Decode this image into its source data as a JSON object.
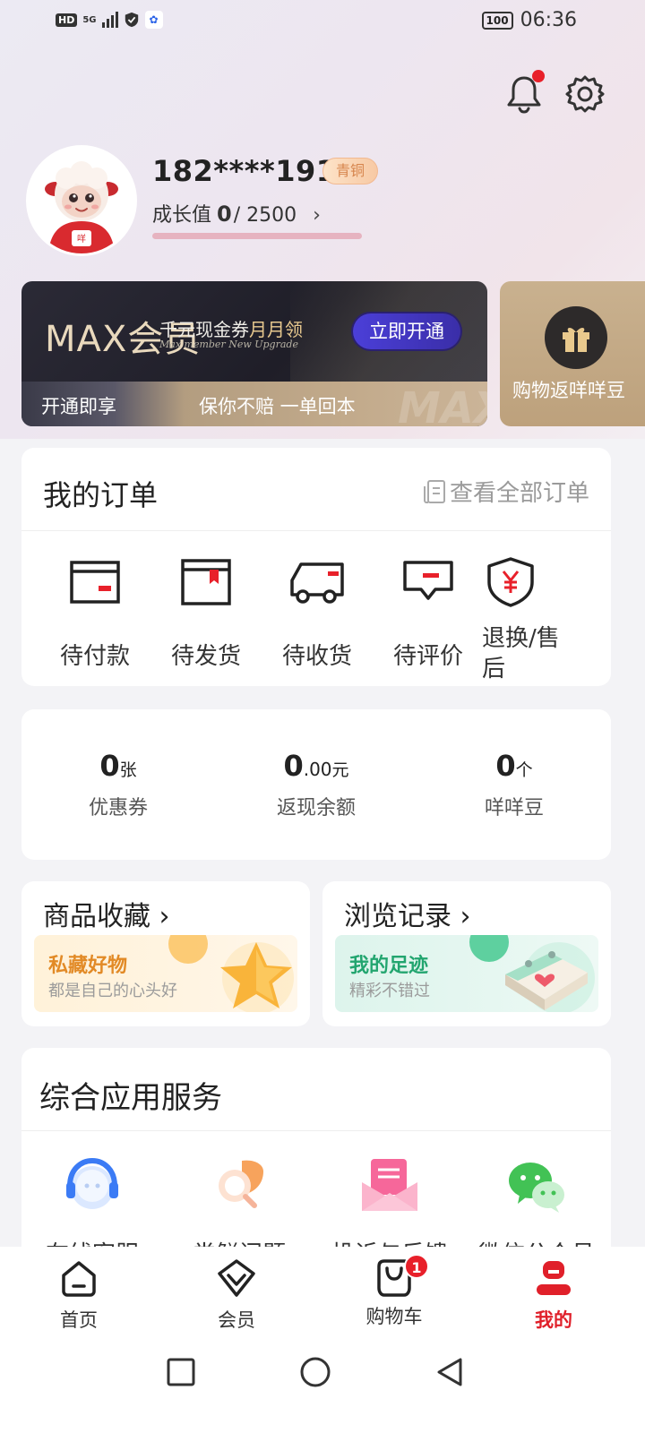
{
  "status_bar": {
    "hd": "HD",
    "network": "5G",
    "battery": "100",
    "time": "06:36"
  },
  "profile": {
    "phone": "182****1917",
    "level": "青铜",
    "growth_label": "成长值",
    "growth_current": "0",
    "growth_total": "/ 2500",
    "growth_progress": 0
  },
  "max_banner": {
    "logo": "MAX会员",
    "title_prefix": "千元现金券",
    "title_highlight": "月月领",
    "subtitle": "Max member   New Upgrade",
    "open_button": "立即开通",
    "left_label": "开通即享",
    "promise": "保你不赔 一单回本",
    "watermark": "MAX"
  },
  "rebate_banner": {
    "text": "购物返咩咩豆"
  },
  "orders": {
    "title": "我的订单",
    "view_all": "查看全部订单",
    "items": [
      {
        "label": "待付款",
        "icon": "wallet-icon"
      },
      {
        "label": "待发货",
        "icon": "box-icon"
      },
      {
        "label": "待收货",
        "icon": "truck-icon"
      },
      {
        "label": "待评价",
        "icon": "comment-icon"
      },
      {
        "label": "退换/售后",
        "icon": "yen-shield-icon"
      }
    ]
  },
  "assets": [
    {
      "value": "0",
      "unit": "张",
      "label": "优惠券"
    },
    {
      "value": "0",
      "decimal": ".00",
      "unit": "元",
      "label": "返现余额"
    },
    {
      "value": "0",
      "unit": "个",
      "label": "咩咩豆"
    }
  ],
  "favorites": {
    "title": "商品收藏",
    "banner_title": "私藏好物",
    "banner_sub": "都是自己的心头好"
  },
  "history": {
    "title": "浏览记录",
    "banner_title": "我的足迹",
    "banner_sub": "精彩不错过"
  },
  "services": {
    "title": "综合应用服务",
    "items": [
      {
        "label": "在线客服",
        "icon": "headset-icon"
      },
      {
        "label": "尝鲜问题",
        "icon": "search-leaf-icon"
      },
      {
        "label": "投诉与反馈",
        "icon": "envelope-icon"
      },
      {
        "label": "微信公众号",
        "icon": "wechat-icon"
      }
    ]
  },
  "bottom_nav": [
    {
      "label": "首页",
      "icon": "home-icon"
    },
    {
      "label": "会员",
      "icon": "member-icon"
    },
    {
      "label": "购物车",
      "icon": "cart-icon",
      "badge": "1"
    },
    {
      "label": "我的",
      "icon": "profile-icon",
      "active": true
    }
  ],
  "colors": {
    "accent_red": "#e0202a",
    "orders_red": "#e8202a",
    "max_purple": "#4b3fd8"
  }
}
